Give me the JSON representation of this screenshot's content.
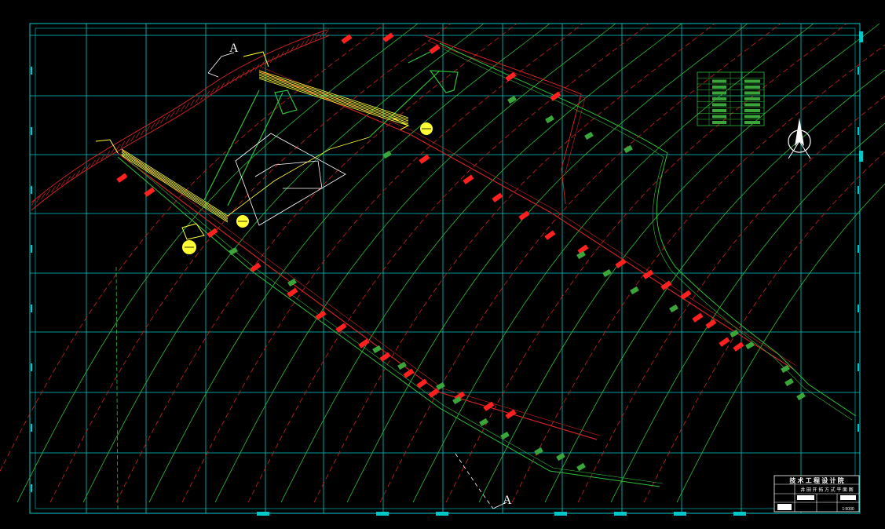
{
  "drawing": {
    "section_mark_top": "A",
    "section_mark_bottom": "A",
    "north_symbol": "north-arrow-icon"
  },
  "title_block": {
    "organization": "技 术 工 程 设 计 院",
    "drawing_title": "井 田 开 拓 方 式 平 面 图",
    "scale": "1:5000"
  },
  "colors": {
    "background": "#000000",
    "grid": "#00c8c8",
    "contour_green": "#2fbf3a",
    "contour_red": "#cc2222",
    "track": "#ffff33",
    "accent_block": "#ff2020",
    "green_block": "#3aa63a"
  }
}
